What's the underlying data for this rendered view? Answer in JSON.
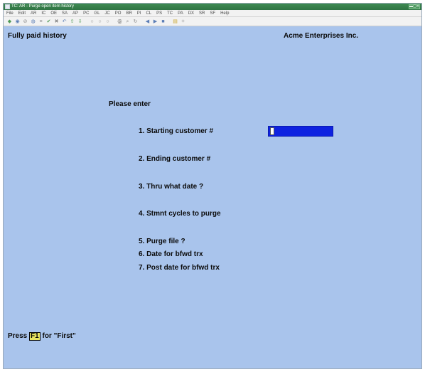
{
  "window": {
    "title": "TC: AR - Purge open item history",
    "controls_glyph": "▬▢✕"
  },
  "menu": {
    "items": [
      "File",
      "Edit",
      "AR",
      "IC",
      "OE",
      "SA",
      "AP",
      "PC",
      "GL",
      "JC",
      "PO",
      "BR",
      "PI",
      "CL",
      "PS",
      "TC",
      "PA",
      "DX",
      "SR",
      "SF",
      "Help"
    ]
  },
  "toolbar": {
    "buttons": [
      {
        "name": "first-record-icon",
        "glyph": "◆",
        "color": "green"
      },
      {
        "name": "find-icon",
        "glyph": "◉",
        "color": "blue"
      },
      {
        "name": "clear-icon",
        "glyph": "⊘",
        "color": "gray"
      },
      {
        "name": "settings-icon",
        "glyph": "◍",
        "color": "blue"
      },
      {
        "name": "list-icon",
        "glyph": "≡",
        "color": "gray"
      },
      {
        "name": "accept-icon",
        "glyph": "✔",
        "color": "green"
      },
      {
        "name": "cancel-icon",
        "glyph": "✖",
        "color": "gray"
      },
      {
        "name": "undo-icon",
        "glyph": "↶",
        "color": "blue"
      },
      {
        "name": "up-icon",
        "glyph": "⇧",
        "color": "green"
      },
      {
        "name": "down-icon",
        "glyph": "⇩",
        "color": "green"
      },
      {
        "name": "circle-1-icon",
        "glyph": "○",
        "color": "gray"
      },
      {
        "name": "circle-2-icon",
        "glyph": "○",
        "color": "gray"
      },
      {
        "name": "circle-3-icon",
        "glyph": "○",
        "color": "gray"
      },
      {
        "name": "binoculars-icon",
        "glyph": "ꙮ",
        "color": "gray"
      },
      {
        "name": "zoom-icon",
        "glyph": "⌕",
        "color": "gray"
      },
      {
        "name": "refresh-icon",
        "glyph": "↻",
        "color": "gray"
      },
      {
        "name": "previous-icon",
        "glyph": "◀",
        "color": "blue"
      },
      {
        "name": "next-icon",
        "glyph": "▶",
        "color": "blue"
      },
      {
        "name": "stop-icon",
        "glyph": "■",
        "color": "blue"
      },
      {
        "name": "calendar-icon",
        "glyph": "▤",
        "color": "yellow"
      },
      {
        "name": "help-icon",
        "glyph": "✧",
        "color": "gray"
      }
    ]
  },
  "screen": {
    "title": "Fully paid history",
    "company": "Acme Enterprises Inc.",
    "prompt": "Please enter",
    "fields": [
      {
        "label": "1. Starting customer #",
        "value": ""
      },
      {
        "label": "2. Ending customer #"
      },
      {
        "label": "3. Thru what date ?"
      },
      {
        "label": "4. Stmnt cycles to purge"
      },
      {
        "label": "5. Purge file ?"
      },
      {
        "label": "6. Date for bfwd trx"
      },
      {
        "label": "7. Post date for bfwd trx"
      }
    ],
    "footer": {
      "prefix": "Press",
      "key": "F1",
      "suffix": "for \"First\""
    }
  },
  "colors": {
    "background": "#a9c4ec",
    "input_field": "#0e22e0",
    "title_bar": "#2f7443",
    "function_key": "#e8e460"
  }
}
